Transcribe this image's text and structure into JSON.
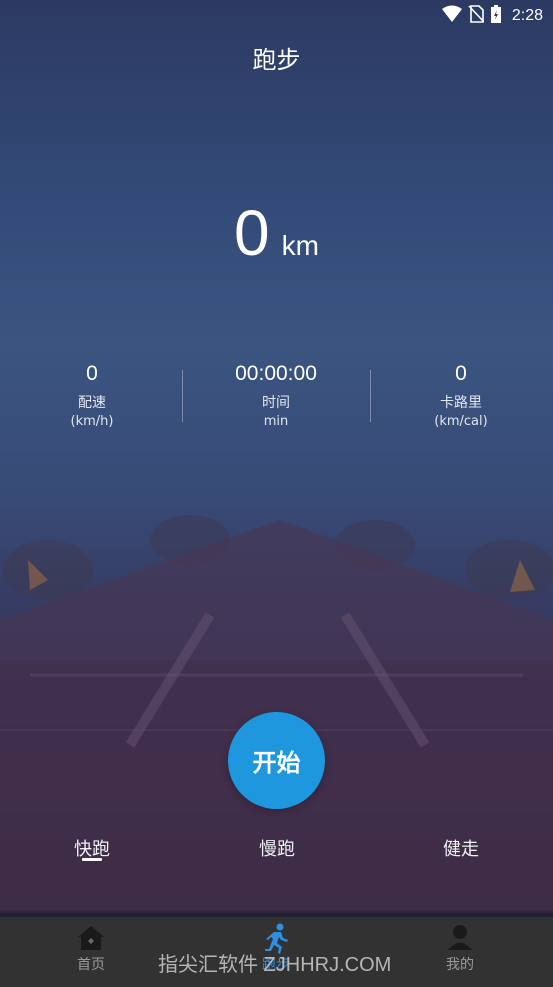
{
  "status_bar": {
    "time": "2:28",
    "icons": [
      "wifi-icon",
      "no-sim-icon",
      "battery-charging-icon"
    ]
  },
  "header": {
    "title": "跑步"
  },
  "distance": {
    "value": "0",
    "unit": "km"
  },
  "stats": [
    {
      "value": "0",
      "label": "配速",
      "unit": "(km/h)"
    },
    {
      "value": "00:00:00",
      "label": "时间",
      "unit": "min"
    },
    {
      "value": "0",
      "label": "卡路里",
      "unit": "(km/cal)"
    }
  ],
  "start_button": {
    "label": "开始",
    "color": "#1f97de"
  },
  "modes": {
    "selected": "快跑",
    "items": [
      "快跑",
      "慢跑",
      "健走"
    ]
  },
  "bottom_nav": {
    "items": [
      {
        "label": "首页",
        "icon": "home-icon",
        "active": false
      },
      {
        "label": "跑步",
        "icon": "runner-icon",
        "active": true
      },
      {
        "label": "我的",
        "icon": "user-icon",
        "active": false
      }
    ],
    "active_color": "#2d8fe0"
  },
  "watermark": {
    "text": "指尖汇软件 ZJHHRJ.COM"
  }
}
